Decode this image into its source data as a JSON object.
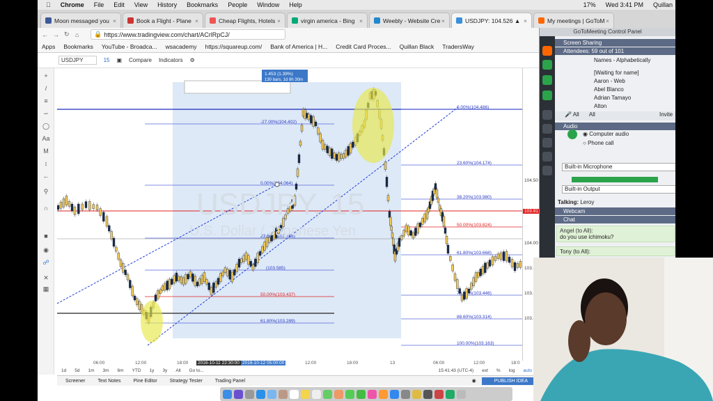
{
  "menubar": {
    "apple": "",
    "app": "Chrome",
    "items": [
      "File",
      "Edit",
      "View",
      "History",
      "Bookmarks",
      "People",
      "Window",
      "Help"
    ],
    "battery": "17%",
    "clock": "Wed 3:41 PM",
    "user": "Quillan"
  },
  "tabs": [
    {
      "label": "Moon messaged you",
      "color": "#3b5998"
    },
    {
      "label": "Book a Flight - Plane",
      "color": "#c33"
    },
    {
      "label": "Cheap Flights, Hotels",
      "color": "#e55"
    },
    {
      "label": "virgin america - Bing",
      "color": "#0a7"
    },
    {
      "label": "Weebly - Website Cre",
      "color": "#28c"
    },
    {
      "label": "USDJPY: 104.526 ▲",
      "color": "#3a8fd9",
      "active": true
    },
    {
      "label": "My meetings | GoToM",
      "color": "#f60"
    }
  ],
  "address": {
    "url": "https://www.tradingview.com/chart/ACrlRpCJ/"
  },
  "bookmarks": [
    "Apps",
    "Bookmarks",
    "YouTube - Broadca...",
    "wsacademy",
    "https://squareup.com/",
    "Bank of America | H...",
    "Credit Card Proces...",
    "Quillan Black",
    "TradersWay"
  ],
  "tv_toolbar": {
    "symbol": "USDJPY",
    "interval": "15",
    "compare": "Compare",
    "indicators": "Indicators"
  },
  "chart": {
    "watermark": "USDJPY, 15",
    "watermark_sub": "U.S. Dollar / Japanese Yen",
    "measure_label": "1.453 (1.39%)",
    "measure_sub": "130 bars, 1d 8h 30m",
    "fib1": [
      {
        "label": "-27.00%(104.402)"
      },
      {
        "label": "0.00%(104.064)"
      },
      {
        "label": "23.60%(103.768)"
      },
      {
        "label": "(103.585)"
      },
      {
        "label": "50.00%(103.437)"
      },
      {
        "label": "61.80%(103.289)"
      }
    ],
    "fib2": [
      {
        "label": "0.00%(104.486)"
      },
      {
        "label": "23.60%(104.174)"
      },
      {
        "label": "38.20%(103.980)"
      },
      {
        "label": "50.00%(103.824)"
      },
      {
        "label": "61.80%(103.668)"
      },
      {
        "label": "78.60%(103.446)"
      },
      {
        "label": "88.60%(103.314)"
      },
      {
        "label": "100.00%(103.163)"
      }
    ],
    "price_ticks": [
      "104.50",
      "104.25",
      "104.00",
      "103.75",
      "103.50",
      "103.25"
    ],
    "time_ticks": [
      "06:00",
      "12:00",
      "18:00",
      "2016-10-11 22:30:00",
      "2016-10-12 05:00:00",
      "12:00",
      "18:00",
      "13",
      "06:00",
      "12:00",
      "18:0"
    ],
    "ranges": [
      "1d",
      "5d",
      "1m",
      "3m",
      "6m",
      "YTD",
      "1y",
      "3y",
      "All",
      "Go to..."
    ],
    "clock_status": "15:41:43 (UTC-4)",
    "axis_opts": [
      "ext",
      "%",
      "log",
      "auto"
    ]
  },
  "bottom_tabs": [
    "Screener",
    "Text Notes",
    "Pine Editor",
    "Strategy Tester",
    "Trading Panel"
  ],
  "publish": "PUBLISH IDEA",
  "gotomeeting": {
    "title": "GoToMeeting Control Panel",
    "screen_sharing": "Screen Sharing",
    "attendees": "Attendees: 59 out of 101",
    "sort": "Names - Alphabetically",
    "names": [
      "[Waiting for name]",
      "Aaron - Web",
      "Abel Blanco",
      "Adrian Tamayo",
      "Alton"
    ],
    "all1": "All",
    "all2": "All",
    "invite": "Invite",
    "audio": "Audio",
    "computer_audio": "Computer audio",
    "phone_call": "Phone call",
    "mic": "Built-in Microphone",
    "output": "Built-in Output",
    "talking_label": "Talking:",
    "talking": "Leroy",
    "webcam": "Webcam",
    "chat": "Chat",
    "chat_msgs": [
      {
        "from": "Angel (to All):",
        "text": "do you use ichimoku?"
      },
      {
        "from": "Tony (to All):",
        "text": ""
      }
    ]
  }
}
